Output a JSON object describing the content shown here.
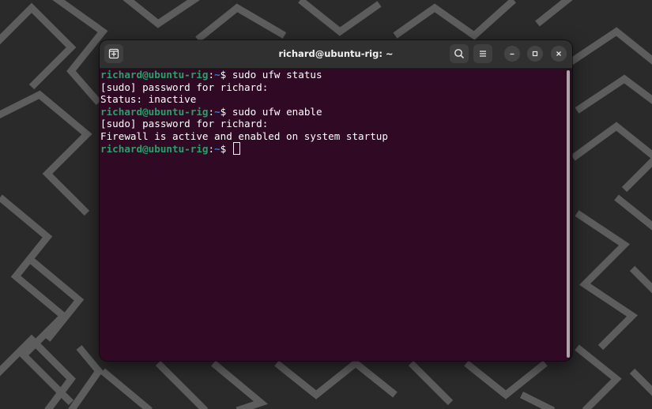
{
  "window": {
    "title": "richard@ubuntu-rig: ~"
  },
  "icons": {
    "new_tab": "new-tab-icon",
    "search": "search-icon",
    "menu": "hamburger-menu-icon",
    "minimize": "minimize-icon",
    "maximize": "maximize-icon",
    "close": "close-icon"
  },
  "colors": {
    "terminal_bg": "#300a24",
    "prompt_user": "#26a269",
    "prompt_path": "#2a7bde",
    "text": "#ffffff"
  },
  "terminal": {
    "lines": [
      {
        "type": "prompt",
        "user": "richard@ubuntu-rig",
        "sep": ":",
        "path": "~",
        "symbol": "$ ",
        "command": "sudo ufw status"
      },
      {
        "type": "output",
        "text": "[sudo] password for richard:"
      },
      {
        "type": "output",
        "text": "Status: inactive"
      },
      {
        "type": "prompt",
        "user": "richard@ubuntu-rig",
        "sep": ":",
        "path": "~",
        "symbol": "$ ",
        "command": "sudo ufw enable"
      },
      {
        "type": "output",
        "text": "[sudo] password for richard:"
      },
      {
        "type": "output",
        "text": "Firewall is active and enabled on system startup"
      },
      {
        "type": "prompt",
        "user": "richard@ubuntu-rig",
        "sep": ":",
        "path": "~",
        "symbol": "$ ",
        "command": ""
      }
    ]
  }
}
